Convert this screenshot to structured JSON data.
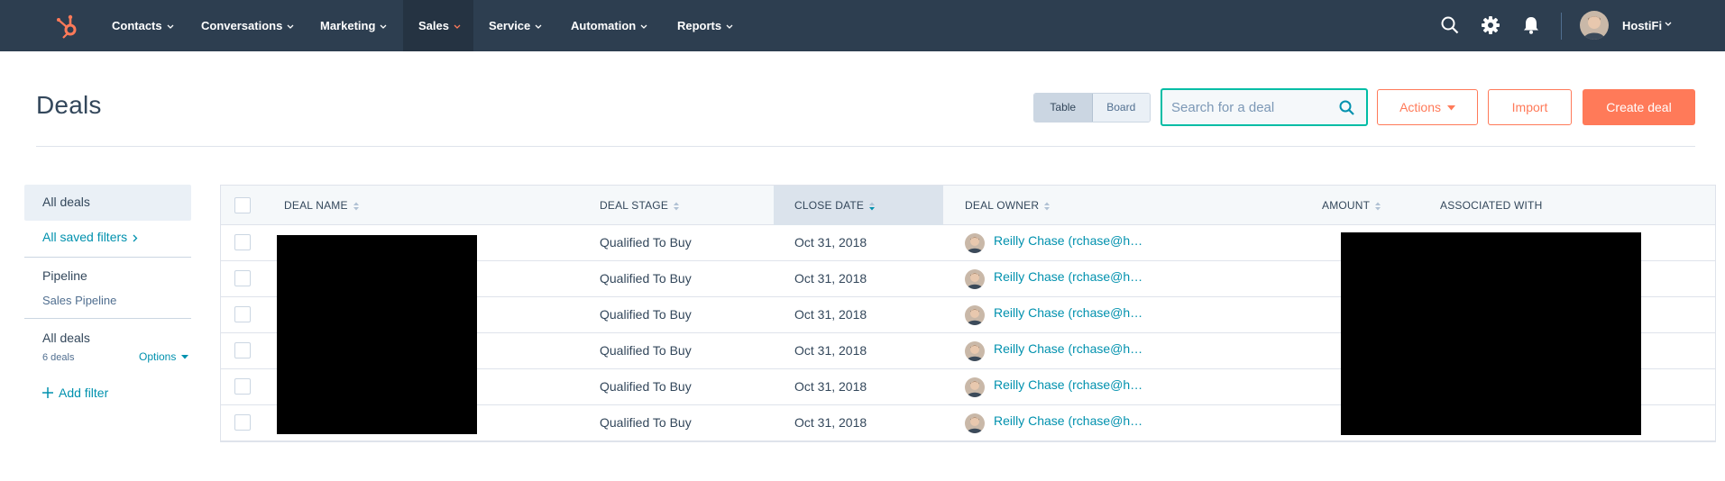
{
  "nav": {
    "items": [
      {
        "label": "Contacts"
      },
      {
        "label": "Conversations"
      },
      {
        "label": "Marketing"
      },
      {
        "label": "Sales"
      },
      {
        "label": "Service"
      },
      {
        "label": "Automation"
      },
      {
        "label": "Reports"
      }
    ],
    "account_name": "HostiFi",
    "colors": {
      "background": "#2d3e50",
      "active": "#253342",
      "brand": "#ff7a59",
      "sales_caret": "#ff7a59"
    }
  },
  "page": {
    "title": "Deals",
    "view_toggle": {
      "table": "Table",
      "board": "Board",
      "selected": "Table"
    },
    "search": {
      "placeholder": "Search for a deal",
      "value": ""
    },
    "actions_label": "Actions",
    "import_label": "Import",
    "create_label": "Create deal"
  },
  "sidebar": {
    "all_deals": "All deals",
    "saved_filters": "All saved filters",
    "pipeline_heading": "Pipeline",
    "pipeline_value": "Sales Pipeline",
    "view_name": "All deals",
    "deal_count": "6 deals",
    "options_label": "Options",
    "add_filter": "Add filter"
  },
  "table": {
    "columns": {
      "deal_name": "DEAL NAME",
      "deal_stage": "DEAL STAGE",
      "close_date": "CLOSE DATE",
      "deal_owner": "DEAL OWNER",
      "amount": "AMOUNT",
      "associated_with": "ASSOCIATED WITH"
    },
    "sorted_column": "CLOSE DATE",
    "sort_direction": "descending",
    "rows": [
      {
        "deal_stage": "Qualified To Buy",
        "close_date": "Oct 31, 2018",
        "deal_owner": "Reilly Chase (rchase@h…"
      },
      {
        "deal_stage": "Qualified To Buy",
        "close_date": "Oct 31, 2018",
        "deal_owner": "Reilly Chase (rchase@h…"
      },
      {
        "deal_stage": "Qualified To Buy",
        "close_date": "Oct 31, 2018",
        "deal_owner": "Reilly Chase (rchase@h…"
      },
      {
        "deal_stage": "Qualified To Buy",
        "close_date": "Oct 31, 2018",
        "deal_owner": "Reilly Chase (rchase@h…"
      },
      {
        "deal_stage": "Qualified To Buy",
        "close_date": "Oct 31, 2018",
        "deal_owner": "Reilly Chase (rchase@h…"
      },
      {
        "deal_stage": "Qualified To Buy",
        "close_date": "Oct 31, 2018",
        "deal_owner": "Reilly Chase (rchase@h…"
      }
    ]
  },
  "icons": {
    "logo": "hubspot-sprocket-icon",
    "search": "search-icon",
    "settings": "gear-icon",
    "notifications": "bell-icon"
  }
}
